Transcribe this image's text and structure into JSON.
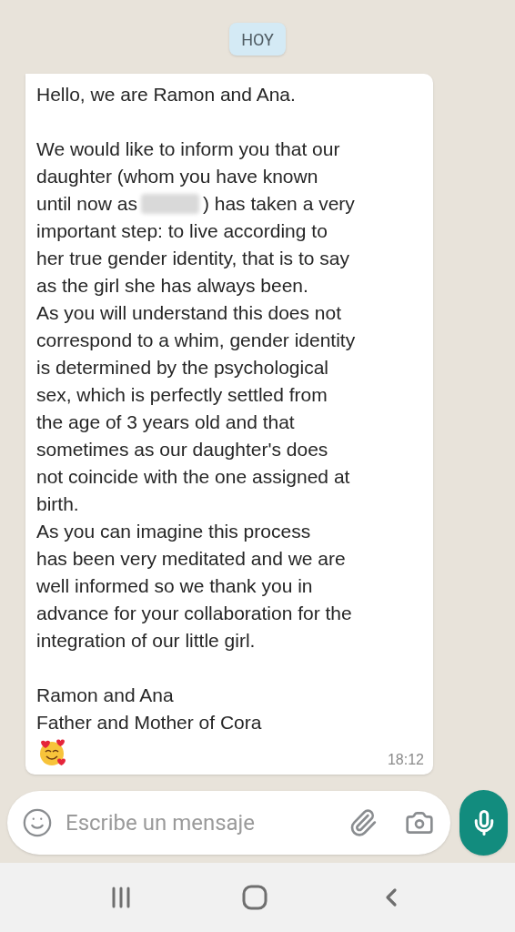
{
  "date_chip": "HOY",
  "message": {
    "lines": [
      {
        "kind": "text",
        "text": "Hello, we are Ramon and Ana."
      },
      {
        "kind": "blank"
      },
      {
        "kind": "text",
        "text": "We would like to inform you that our"
      },
      {
        "kind": "text",
        "text": "daughter (whom you have known"
      },
      {
        "kind": "redacted",
        "before": "until now as",
        "after": ") has taken a very"
      },
      {
        "kind": "text",
        "text": "important step: to live according to"
      },
      {
        "kind": "text",
        "text": "her true gender identity, that is to say"
      },
      {
        "kind": "text",
        "text": "as the girl she has always been."
      },
      {
        "kind": "text",
        "text": "As you will understand this does not"
      },
      {
        "kind": "text",
        "text": "correspond to a whim, gender identity"
      },
      {
        "kind": "text",
        "text": "is determined by the psychological"
      },
      {
        "kind": "text",
        "text": "sex, which is perfectly settled from"
      },
      {
        "kind": "text",
        "text": "the age of 3 years old and that"
      },
      {
        "kind": "text",
        "text": "sometimes as our daughter's does"
      },
      {
        "kind": "text",
        "text": "not coincide with the one assigned at"
      },
      {
        "kind": "text",
        "text": "birth."
      },
      {
        "kind": "text",
        "text": "As you can imagine this process"
      },
      {
        "kind": "text",
        "text": "has been very meditated and we are"
      },
      {
        "kind": "text",
        "text": "well informed so we thank you in"
      },
      {
        "kind": "text",
        "text": "advance for your collaboration for the"
      },
      {
        "kind": "text",
        "text": "integration of our little girl."
      },
      {
        "kind": "blank"
      },
      {
        "kind": "text",
        "text": "Ramon and Ana"
      },
      {
        "kind": "text",
        "text": "Father and Mother of Cora"
      },
      {
        "kind": "emoji"
      }
    ],
    "time": "18:12"
  },
  "composer": {
    "placeholder": "Escribe un mensaje"
  }
}
